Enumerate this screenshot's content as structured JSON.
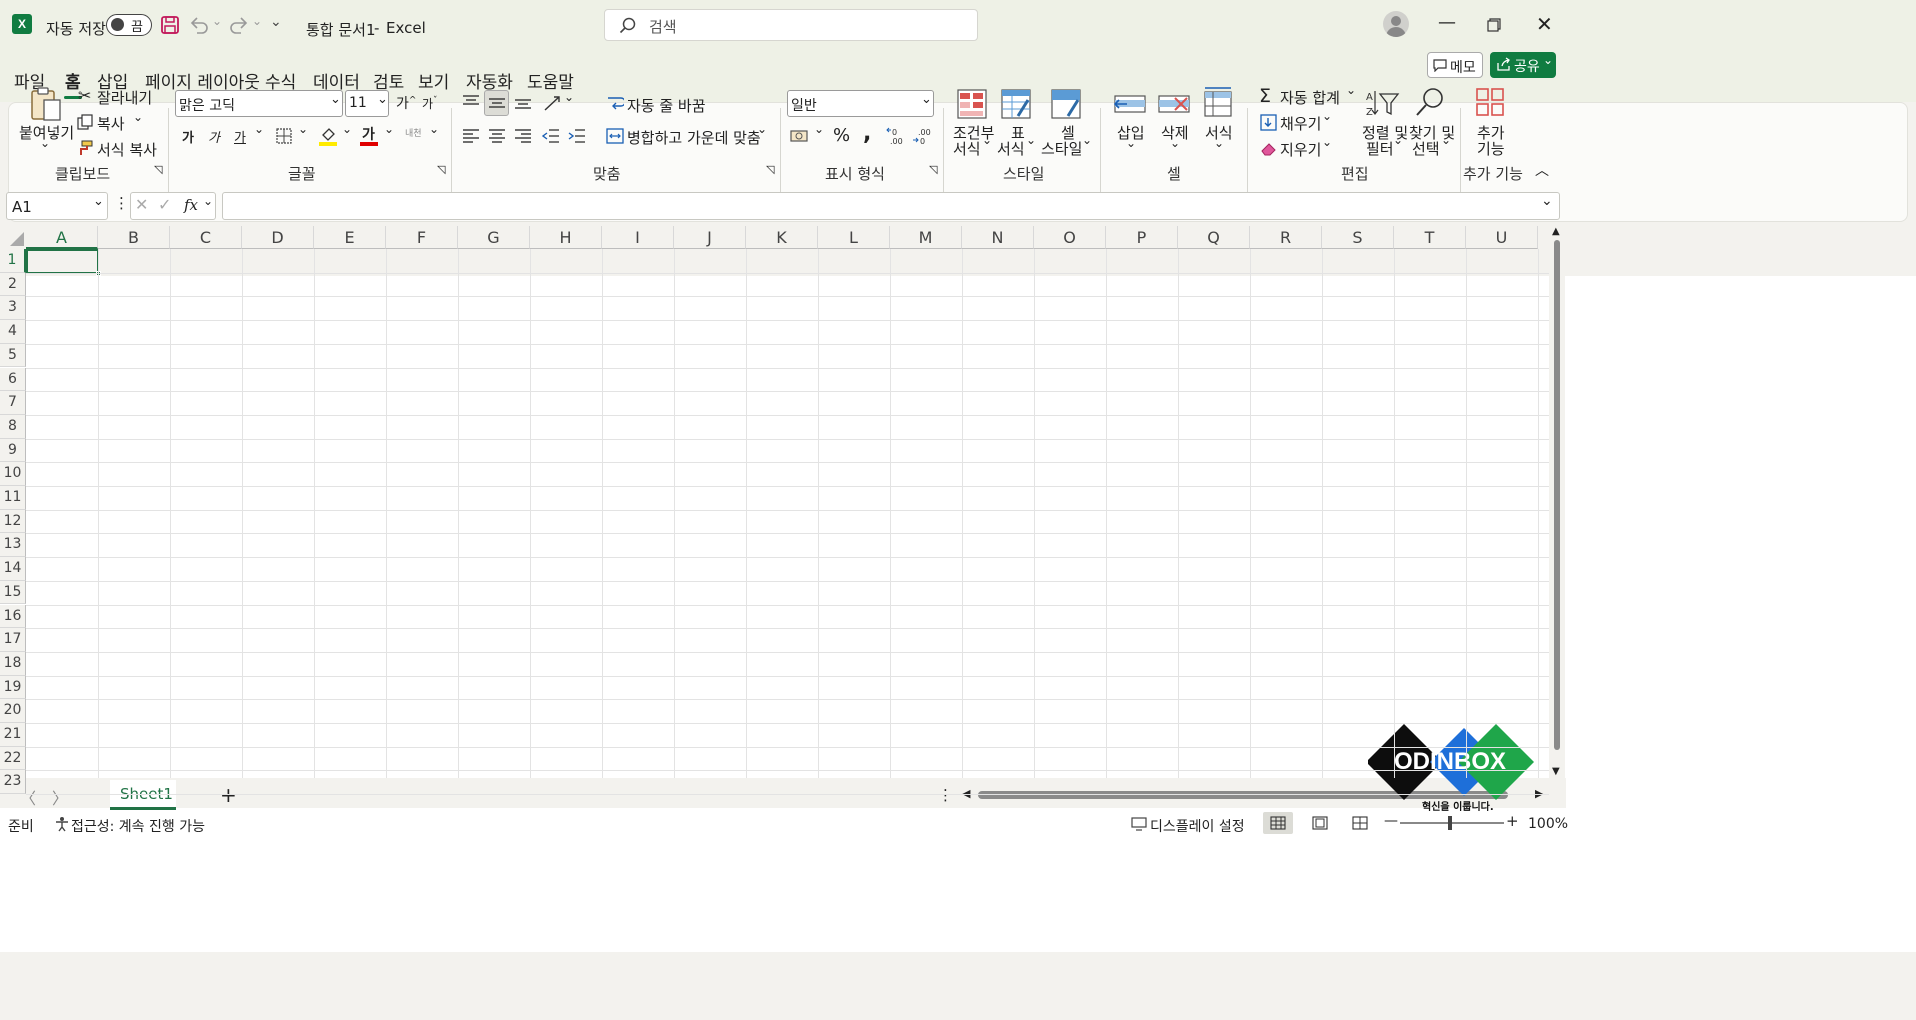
{
  "titlebar": {
    "autosave_label": "자동 저장",
    "autosave_state": "끔",
    "doc_title": "통합 문서1",
    "separator": "-",
    "app_name": "Excel",
    "search_placeholder": "검색"
  },
  "tabs": [
    "파일",
    "홈",
    "삽입",
    "페이지 레이아웃",
    "수식",
    "데이터",
    "검토",
    "보기",
    "자동화",
    "도움말"
  ],
  "active_tab": "홈",
  "header_buttons": {
    "memo": "메모",
    "share": "공유"
  },
  "ribbon": {
    "clipboard": {
      "paste": "붙여넣기",
      "cut": "잘라내기",
      "copy": "복사",
      "format_painter": "서식 복사",
      "group": "클립보드"
    },
    "font": {
      "name": "맑은 고딕",
      "size": "11",
      "bold": "가",
      "italic": "가",
      "underline": "가",
      "group": "글꼴",
      "grow": "가",
      "shrink": "가",
      "phonetic": "내천"
    },
    "alignment": {
      "wrap": "자동 줄 바꿈",
      "merge": "병합하고 가운데 맞춤",
      "group": "맞춤"
    },
    "number": {
      "format": "일반",
      "percent": "%",
      "comma": ",",
      "group": "표시 형식"
    },
    "styles": {
      "conditional_1": "조건부",
      "conditional_2": "서식",
      "table_1": "표",
      "table_2": "서식",
      "cell_1": "셀",
      "cell_2": "스타일",
      "group": "스타일"
    },
    "cells": {
      "insert": "삽입",
      "delete": "삭제",
      "format": "서식",
      "group": "셀"
    },
    "editing": {
      "autosum": "자동 합계",
      "fill": "채우기",
      "clear": "지우기",
      "sort_1": "정렬 및",
      "sort_2": "필터",
      "find_1": "찾기 및",
      "find_2": "선택",
      "group": "편집"
    },
    "addins": {
      "label_1": "추가",
      "label_2": "기능",
      "group": "추가 기능"
    }
  },
  "formula_bar": {
    "name_box": "A1",
    "fx": "fx",
    "value": ""
  },
  "columns": [
    "A",
    "B",
    "C",
    "D",
    "E",
    "F",
    "G",
    "H",
    "I",
    "J",
    "K",
    "L",
    "M",
    "N",
    "O",
    "P",
    "Q",
    "R",
    "S",
    "T",
    "U"
  ],
  "rows": [
    "1",
    "2",
    "3",
    "4",
    "5",
    "6",
    "7",
    "8",
    "9",
    "10",
    "11",
    "12",
    "13",
    "14",
    "15",
    "16",
    "17",
    "18",
    "19",
    "20",
    "21",
    "22",
    "23"
  ],
  "sheet_tabs": [
    "Sheet1"
  ],
  "status": {
    "ready": "준비",
    "accessibility": "접근성: 계속 진행 가능",
    "display_settings": "디스플레이 설정",
    "zoom": "100%"
  },
  "watermark": {
    "brand": "ODINBOX",
    "tagline": "혁신을 이룹니다."
  },
  "colors": {
    "excel_green": "#107c41",
    "share_green": "#107c41",
    "selection_green": "#217346",
    "ribbon_bg": "#fbfbf9",
    "title_bg": "#eef1e6"
  }
}
